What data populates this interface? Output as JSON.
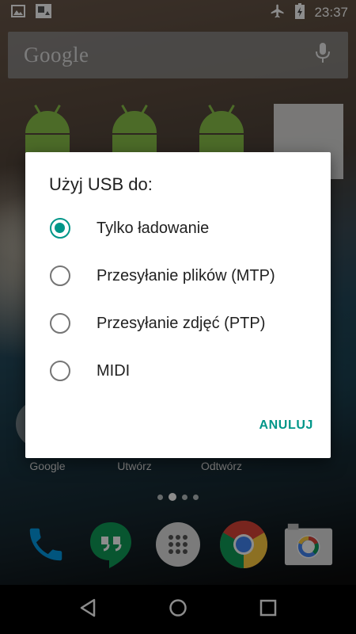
{
  "status_bar": {
    "time": "23:37",
    "left_icons": [
      "image-icon",
      "gallery-notification-icon"
    ],
    "right_icons": [
      "airplane-icon",
      "battery-charging-icon"
    ]
  },
  "search": {
    "logo_text": "Google",
    "mic_icon": "microphone-icon"
  },
  "home": {
    "app_labels": [
      "Google",
      "Utwórz",
      "Odtwórz"
    ],
    "page_dots": 4,
    "active_page": 2
  },
  "dock": {
    "apps": [
      {
        "name": "phone",
        "icon": "phone-icon"
      },
      {
        "name": "hangouts",
        "icon": "hangouts-icon"
      },
      {
        "name": "app-drawer",
        "icon": "app-drawer-icon"
      },
      {
        "name": "chrome",
        "icon": "chrome-icon"
      },
      {
        "name": "camera",
        "icon": "camera-icon"
      }
    ]
  },
  "dialog": {
    "title": "Użyj USB do:",
    "options": [
      {
        "label": "Tylko ładowanie",
        "selected": true
      },
      {
        "label": "Przesyłanie plików (MTP)",
        "selected": false
      },
      {
        "label": "Przesyłanie zdjęć (PTP)",
        "selected": false
      },
      {
        "label": "MIDI",
        "selected": false
      }
    ],
    "cancel_label": "ANULUJ"
  },
  "colors": {
    "accent": "#009688",
    "radio_unchecked": "#757575",
    "dialog_bg": "#ffffff"
  },
  "nav_bar": {
    "icons": [
      "back-icon",
      "home-icon",
      "recents-icon"
    ]
  }
}
